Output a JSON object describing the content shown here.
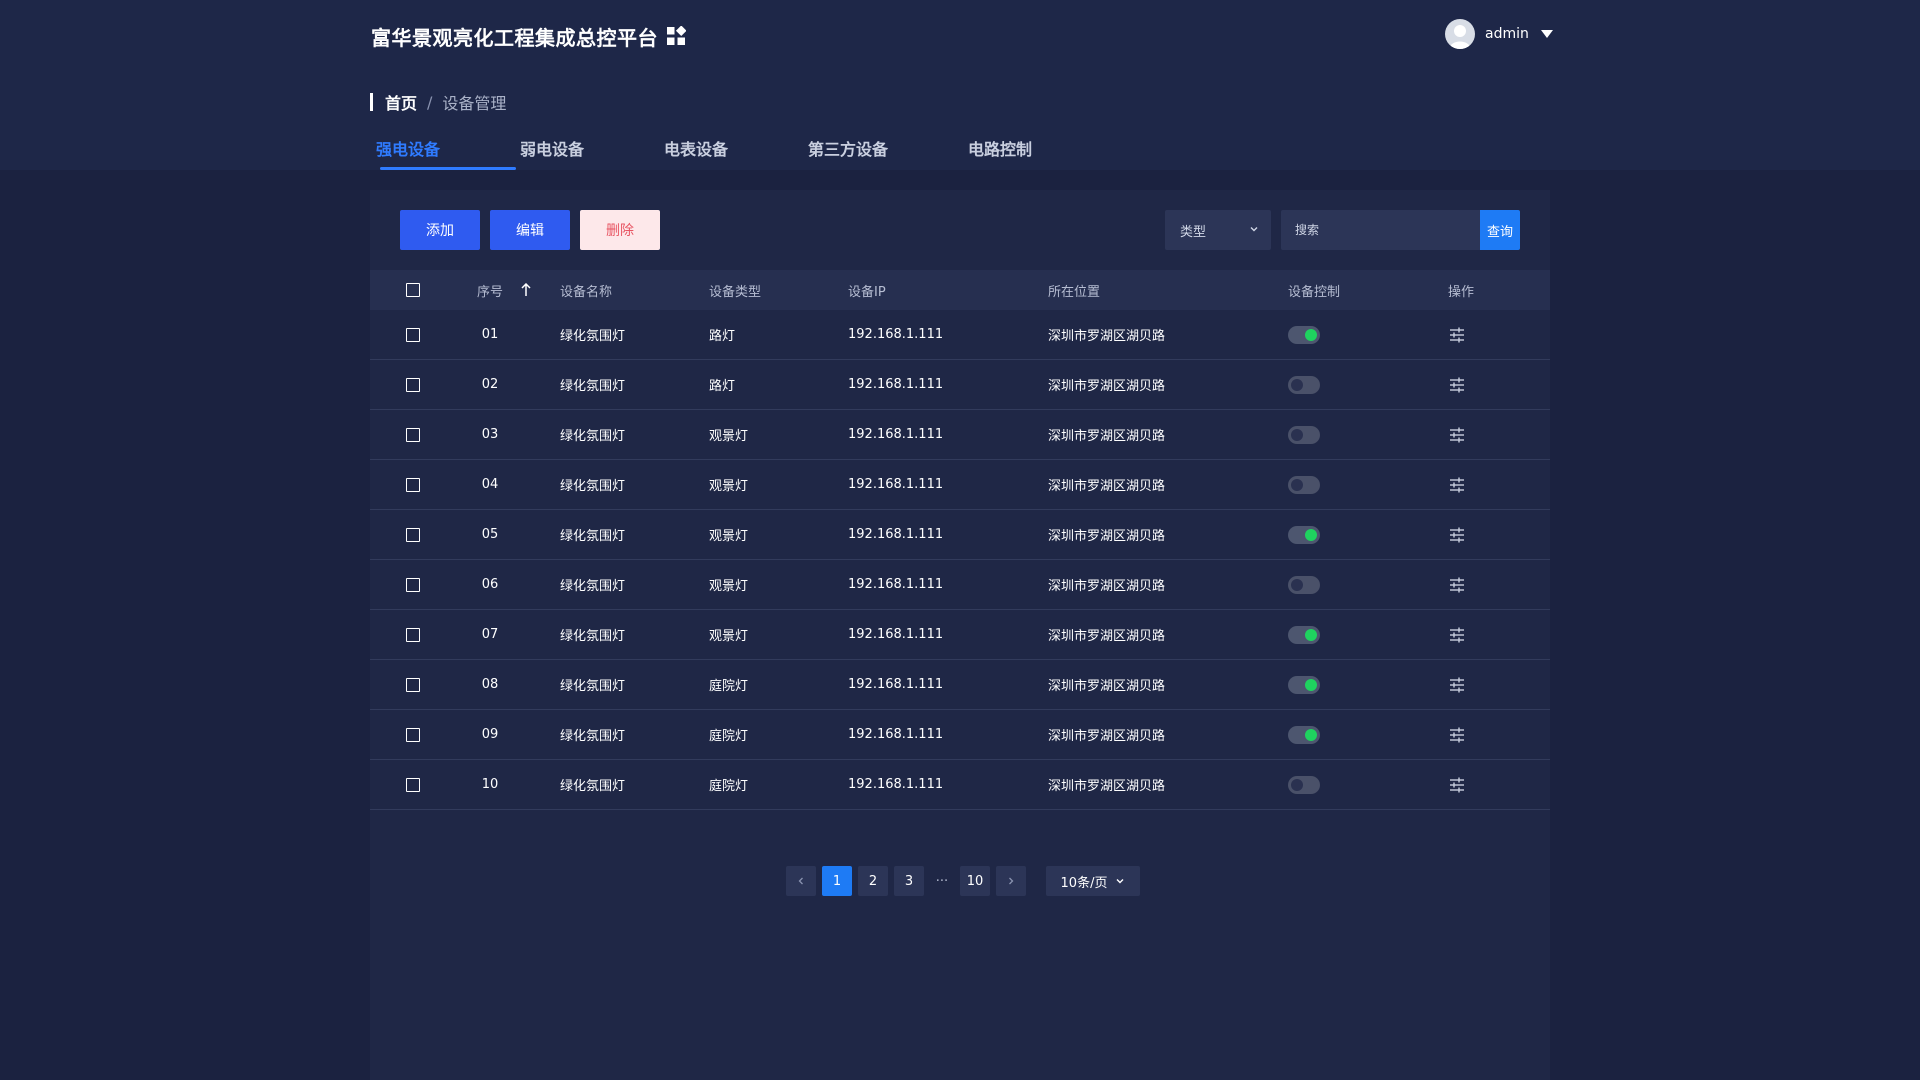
{
  "header": {
    "title": "富华景观亮化工程集成总控平台",
    "user": "admin"
  },
  "breadcrumb": {
    "home": "首页",
    "separator": "/",
    "current": "设备管理"
  },
  "tabs": [
    {
      "label": "强电设备",
      "active": true
    },
    {
      "label": "弱电设备",
      "active": false
    },
    {
      "label": "电表设备",
      "active": false
    },
    {
      "label": "第三方设备",
      "active": false
    },
    {
      "label": "电路控制",
      "active": false
    }
  ],
  "toolbar": {
    "add_label": "添加",
    "edit_label": "编辑",
    "delete_label": "删除",
    "type_select": "类型",
    "search_placeholder": "搜索",
    "search_button": "查询"
  },
  "table": {
    "columns": {
      "no": "序号",
      "name": "设备名称",
      "type": "设备类型",
      "ip": "设备IP",
      "location": "所在位置",
      "control": "设备控制",
      "action": "操作"
    },
    "rows": [
      {
        "no": "01",
        "name": "绿化氛围灯",
        "type": "路灯",
        "ip": "192.168.1.111",
        "location": "深圳市罗湖区湖贝路",
        "on": true
      },
      {
        "no": "02",
        "name": "绿化氛围灯",
        "type": "路灯",
        "ip": "192.168.1.111",
        "location": "深圳市罗湖区湖贝路",
        "on": false
      },
      {
        "no": "03",
        "name": "绿化氛围灯",
        "type": "观景灯",
        "ip": "192.168.1.111",
        "location": "深圳市罗湖区湖贝路",
        "on": false
      },
      {
        "no": "04",
        "name": "绿化氛围灯",
        "type": "观景灯",
        "ip": "192.168.1.111",
        "location": "深圳市罗湖区湖贝路",
        "on": false
      },
      {
        "no": "05",
        "name": "绿化氛围灯",
        "type": "观景灯",
        "ip": "192.168.1.111",
        "location": "深圳市罗湖区湖贝路",
        "on": true
      },
      {
        "no": "06",
        "name": "绿化氛围灯",
        "type": "观景灯",
        "ip": "192.168.1.111",
        "location": "深圳市罗湖区湖贝路",
        "on": false
      },
      {
        "no": "07",
        "name": "绿化氛围灯",
        "type": "观景灯",
        "ip": "192.168.1.111",
        "location": "深圳市罗湖区湖贝路",
        "on": true
      },
      {
        "no": "08",
        "name": "绿化氛围灯",
        "type": "庭院灯",
        "ip": "192.168.1.111",
        "location": "深圳市罗湖区湖贝路",
        "on": true
      },
      {
        "no": "09",
        "name": "绿化氛围灯",
        "type": "庭院灯",
        "ip": "192.168.1.111",
        "location": "深圳市罗湖区湖贝路",
        "on": true
      },
      {
        "no": "10",
        "name": "绿化氛围灯",
        "type": "庭院灯",
        "ip": "192.168.1.111",
        "location": "深圳市罗湖区湖贝路",
        "on": false
      }
    ]
  },
  "pagination": {
    "pages": [
      "1",
      "2",
      "3"
    ],
    "ellipsis": "···",
    "last": "10",
    "current": "1",
    "page_size": "10条/页"
  },
  "colors": {
    "background": "#1b2240",
    "accent": "#2f7bff",
    "toggle_on": "#1fd35f",
    "delete_text": "#e85563"
  }
}
